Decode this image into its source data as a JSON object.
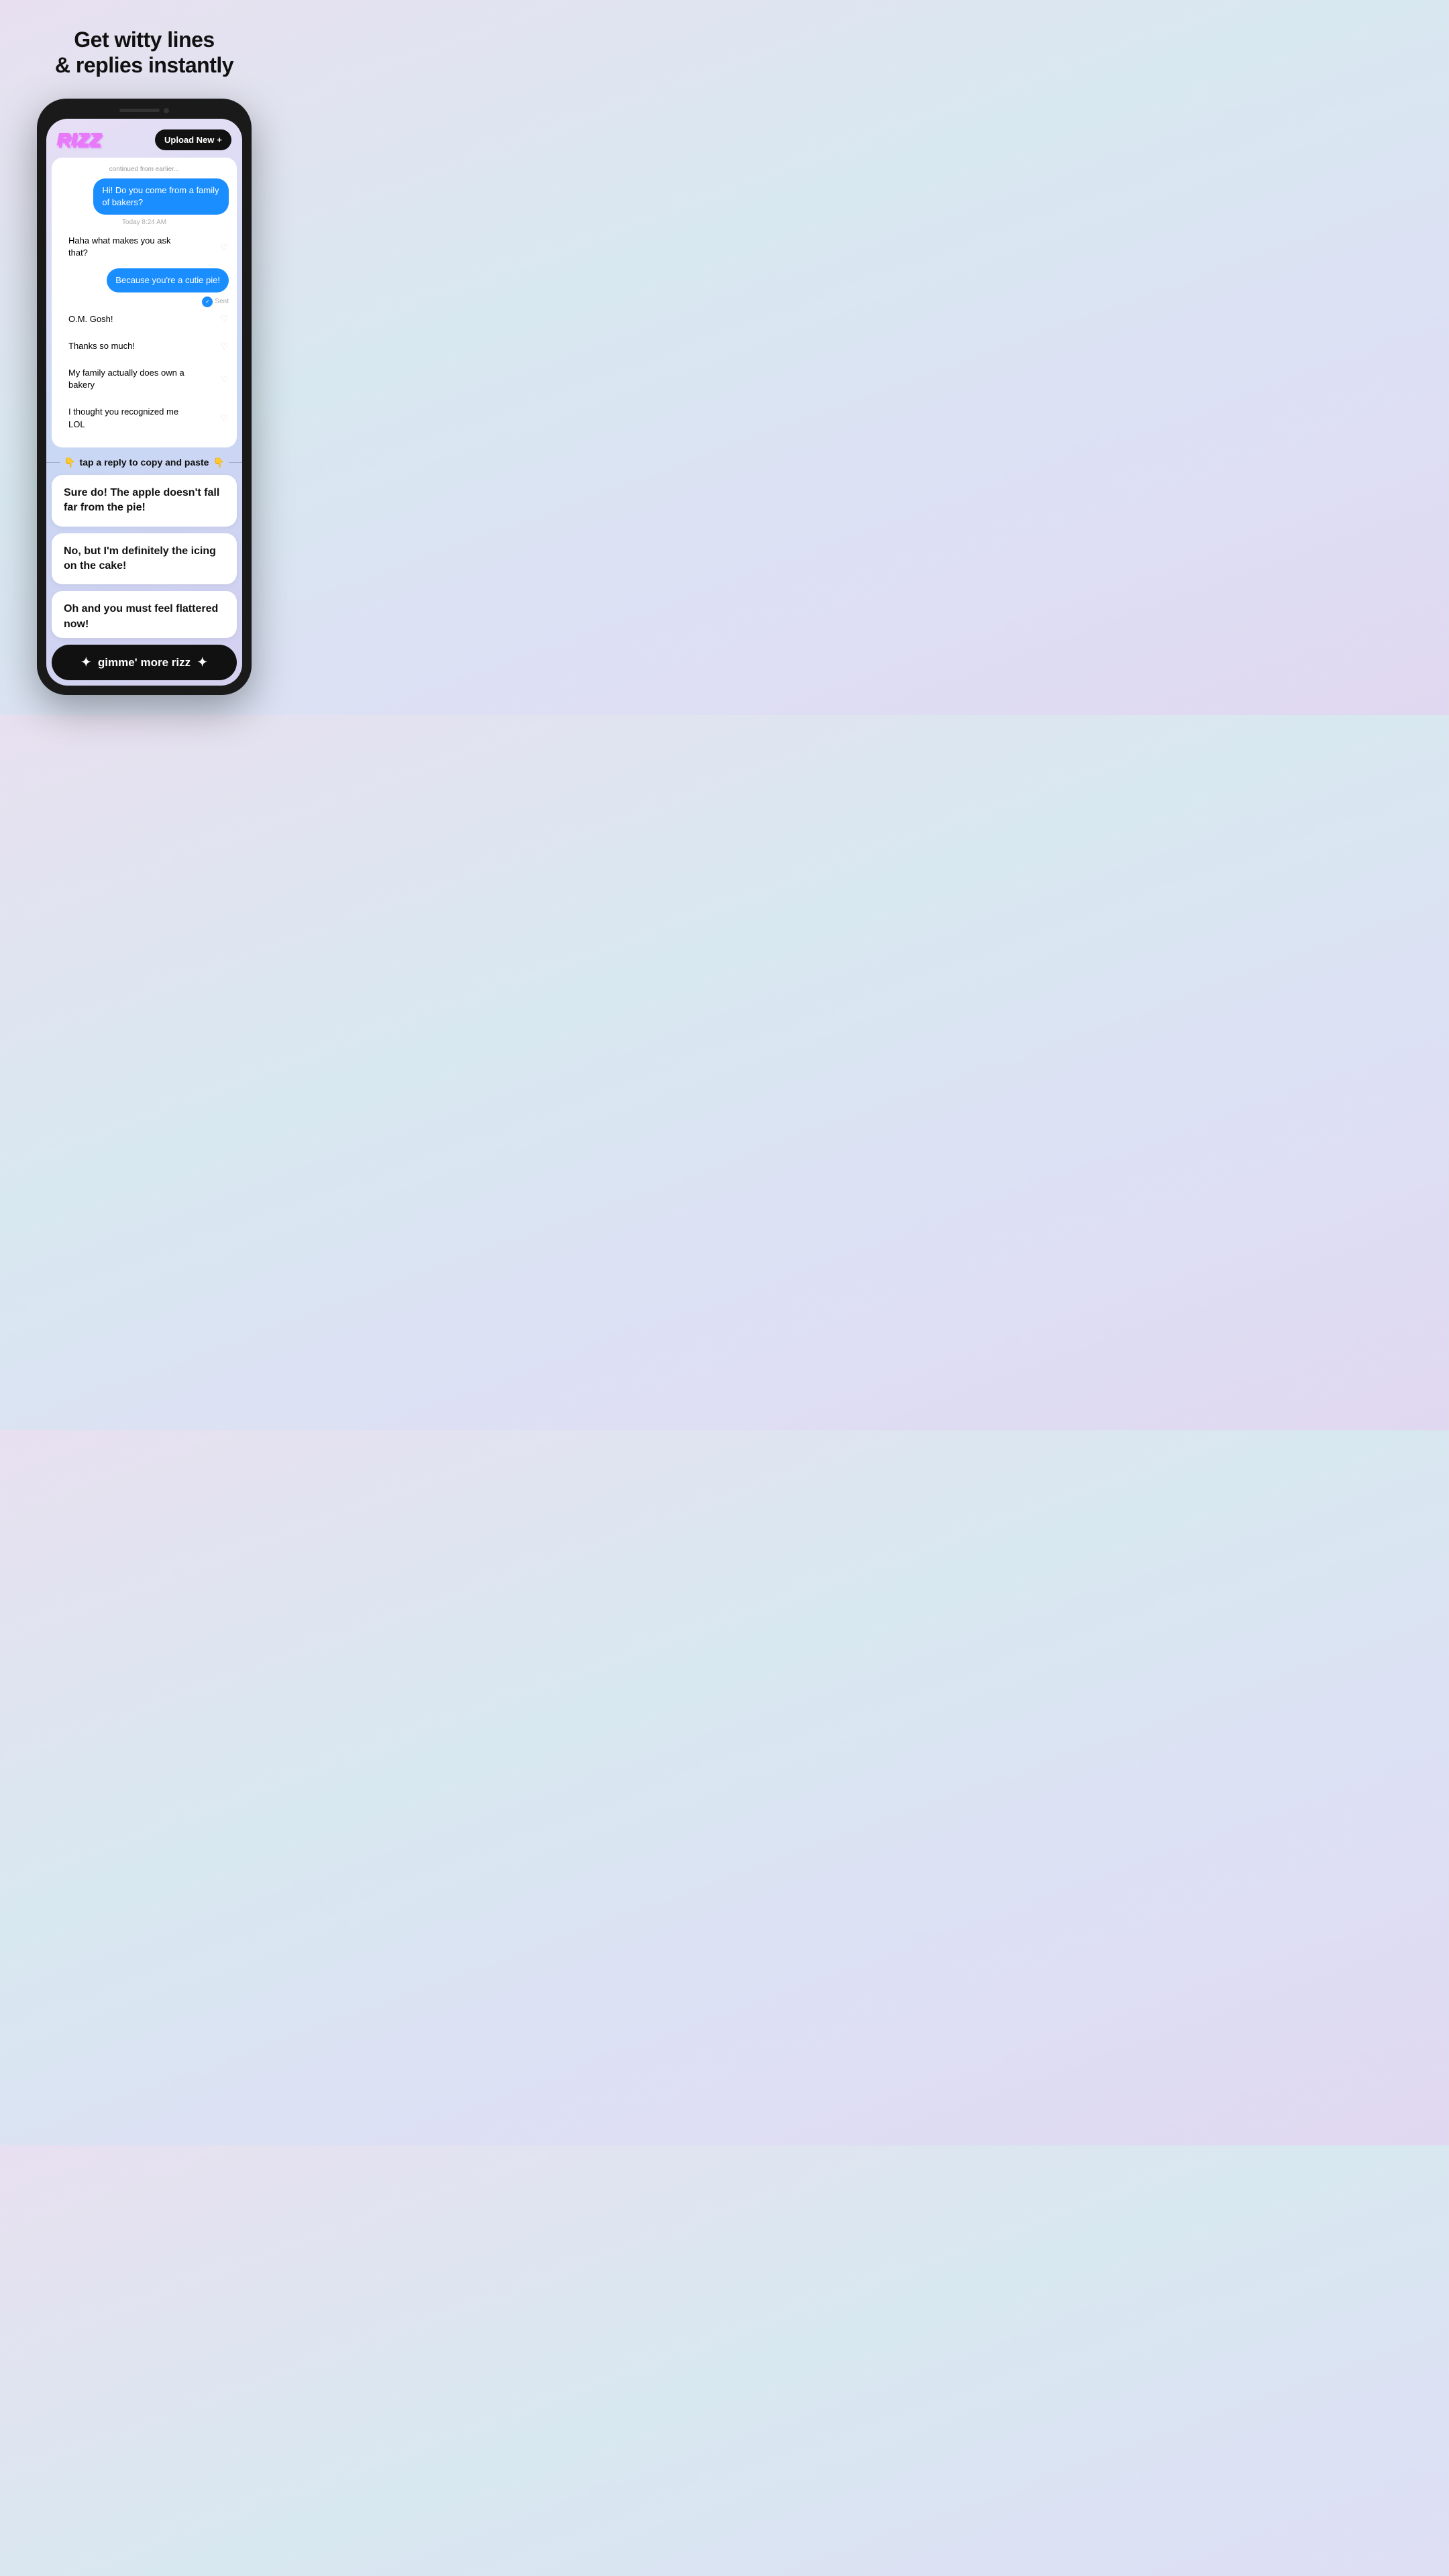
{
  "page": {
    "title_line1": "Get witty lines",
    "title_line2": "& replies instantly"
  },
  "header": {
    "logo": "RIZZ",
    "upload_btn_label": "Upload New",
    "upload_btn_icon": "+"
  },
  "chat": {
    "header_faded": "continued from earlier...",
    "messages": [
      {
        "id": 1,
        "type": "sent",
        "text": "Hi!  Do you come from a family of bakers?"
      },
      {
        "id": 2,
        "type": "timestamp",
        "text": "Today 8:24 AM"
      },
      {
        "id": 3,
        "type": "received",
        "text": "Haha what makes you ask that?"
      },
      {
        "id": 4,
        "type": "sent",
        "text": "Because you're a cutie pie!"
      },
      {
        "id": 5,
        "type": "sent_status",
        "text": "Sent"
      },
      {
        "id": 6,
        "type": "received",
        "text": "O.M. Gosh!"
      },
      {
        "id": 7,
        "type": "received",
        "text": "Thanks so much!"
      },
      {
        "id": 8,
        "type": "received",
        "text": "My family actually does own a bakery"
      },
      {
        "id": 9,
        "type": "received",
        "text": "I thought you recognized me LOL"
      }
    ]
  },
  "tap_instruction": {
    "emoji": "👇",
    "text": "tap a reply to copy and paste"
  },
  "replies": [
    {
      "id": 1,
      "text": "Sure do! The apple doesn't fall far from the pie!"
    },
    {
      "id": 2,
      "text": "No, but I'm definitely the icing on the cake!"
    },
    {
      "id": 3,
      "text": "Oh and you must feel flattered now!"
    }
  ],
  "gimme_btn": {
    "icon": "✦",
    "label": "gimme' more rizz"
  }
}
